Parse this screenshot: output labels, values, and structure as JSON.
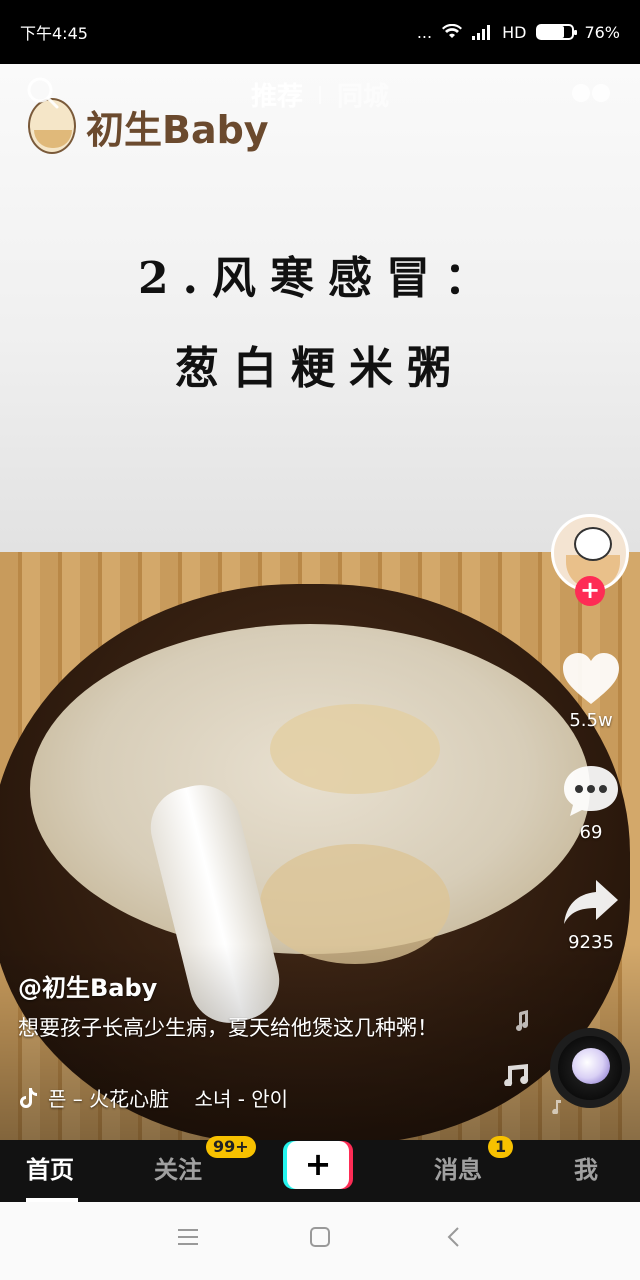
{
  "status_bar": {
    "time": "下午4:45",
    "dots": "...",
    "network": "HD",
    "battery_percent": "76%",
    "battery_level": 0.76
  },
  "top_tabs": {
    "recommend": "推荐",
    "local": "同城"
  },
  "video": {
    "brand_text": "初生Baby",
    "overlay_line1": "2.风寒感冒：",
    "overlay_line2": "葱白粳米粥"
  },
  "actions": {
    "likes": "5.5w",
    "comments": "69",
    "shares": "9235",
    "follow_symbol": "+"
  },
  "post": {
    "author": "@初生Baby",
    "caption": "想要孩子长高少生病，夏天给他煲这几种粥！",
    "music": "픈 – 火花心脏    소녀 - 안이"
  },
  "bottom_nav": {
    "home": "首页",
    "follow": "关注",
    "follow_badge": "99+",
    "create": "+",
    "messages": "消息",
    "messages_badge": "1",
    "me": "我"
  },
  "colors": {
    "accent_red": "#fe2c55",
    "accent_cyan": "#25f4ee",
    "badge_yellow": "#f7c100"
  },
  "icons": [
    "search-icon",
    "heart-icon",
    "comment-icon",
    "share-icon",
    "tiktok-note-icon",
    "music-disc",
    "menu-icon",
    "home-square-icon",
    "back-chevron-icon"
  ]
}
